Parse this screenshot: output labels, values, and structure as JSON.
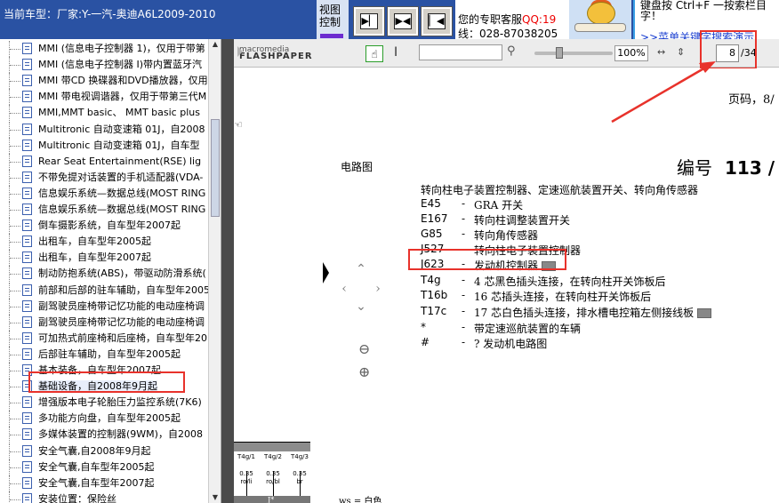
{
  "header": {
    "car_model": "当前车型：厂家:Y-一汽-奥迪A6L2009-2010",
    "view_control": "视图控制",
    "view_buttons": [
      "▶▏",
      "▶◀",
      "▏◀"
    ],
    "service_line1": "您的专职客服",
    "service_qq": "QQ:19",
    "service_line2": "线：028-87038205",
    "tip_line1": "键盘按   Ctrl+F   一按索栏目",
    "tip_line2": "字！",
    "tip_link": ">>菜单关键字搜索演示"
  },
  "sidebar": {
    "items": [
      "MMI (信息电子控制器 1)，仅用于带第",
      "MMI (信息电子控制器 I)带内置蓝牙汽",
      "MMI 带CD 换碟器和DVD播放器，仅用",
      "MMI 带电视调谐器，仅用于带第三代M",
      "MMI,MMT basic、 MMT basic plus",
      "Multitronic 自动变速箱 01J，自2008",
      "Multitronic 自动变速箱 01J，自车型",
      "Rear Seat Entertainment(RSE) lig",
      "不带免提对话装置的手机适配器(VDA-",
      "信息娱乐系统—数据总线(MOST RING",
      "信息娱乐系统—数据总线(MOST RING",
      "倒车摄影系统，自车型年2007起",
      "出租车，自车型年2005起",
      "出租车，自车型年2007起",
      "制动防抱系统(ABS)，带驱动防滑系统(",
      "前部和后部的驻车辅助，自车型年2005",
      "副驾驶员座椅带记忆功能的电动座椅调",
      "副驾驶员座椅带记忆功能的电动座椅调",
      "可加热式前座椅和后座椅，自车型年20",
      "后部驻车辅助，自车型年2005起",
      "基本装备，自车型年2007起",
      "基础设备，自2008年9月起",
      "增强版本电子轮胎压力监控系统(7K6)",
      "多功能方向盘，自车型年2005起",
      "多媒体装置的控制器(9WM)，自2008",
      "安全气囊,自2008年9月起",
      "安全气囊,自车型年2005起",
      "安全气囊,自车型年2007起",
      "安装位置：保险丝"
    ],
    "selected_index": 21
  },
  "viewer": {
    "logo_top": "macromedia",
    "logo_main": "FLASHPAPER",
    "hand_glyph": "☝",
    "ibeam_glyph": "I",
    "search_glyph": "⚲",
    "zoom": "100%",
    "fit_width_glyph": "↔",
    "fit_page_glyph": "⇕",
    "page_current": "8",
    "page_total": "/34"
  },
  "document": {
    "page_number": "页码，8/",
    "pointer_glyph": "☜",
    "section_title": "电路图",
    "code_label": "编号",
    "code_value": "113 /",
    "heading": "转向柱电子装置控制器、定速巡航装置开关、转向角传感器",
    "rows": [
      {
        "code": "E45",
        "dash": "-",
        "text": "GRA 开关"
      },
      {
        "code": "E167",
        "dash": "-",
        "text": "转向柱调整装置开关"
      },
      {
        "code": "G85",
        "dash": "-",
        "text": "转向角传感器"
      },
      {
        "code": "J527",
        "dash": "-",
        "text": "转向柱电子装置控制器"
      },
      {
        "code": "J623",
        "dash": "-",
        "text": "发动机控制器"
      },
      {
        "code": "T4g",
        "dash": "-",
        "text": "4 芯黑色插头连接，在转向柱开关饰板后"
      },
      {
        "code": "T16b",
        "dash": "-",
        "text": "16 芯插头连接，在转向柱开关饰板后"
      },
      {
        "code": "T17c",
        "dash": "-",
        "text": "17 芯白色插头连接，排水槽电控箱左侧接线板"
      },
      {
        "code": "*",
        "dash": "-",
        "text": "带定速巡航装置的车辆"
      },
      {
        "code": "#",
        "dash": "-",
        "text": "? 发动机电路图"
      }
    ],
    "nav": {
      "up": "⌃",
      "down": "⌄",
      "left": "‹",
      "right": "›"
    },
    "zoom_in_glyph": "⊕",
    "zoom_out_glyph": "⊖",
    "diagram_labels": [
      {
        "pin": "T4g/1",
        "val": "0.35",
        "color": "ro/li"
      },
      {
        "pin": "T4g/2",
        "val": "0.35",
        "color": "ro/bl"
      },
      {
        "pin": "T4g/3",
        "val": "0.35",
        "color": "br"
      }
    ],
    "diagram_foot": "J*",
    "legend": "ws = 白色"
  },
  "colors": {
    "highlight": "#e8322b",
    "header_bg": "#2a52a3"
  }
}
